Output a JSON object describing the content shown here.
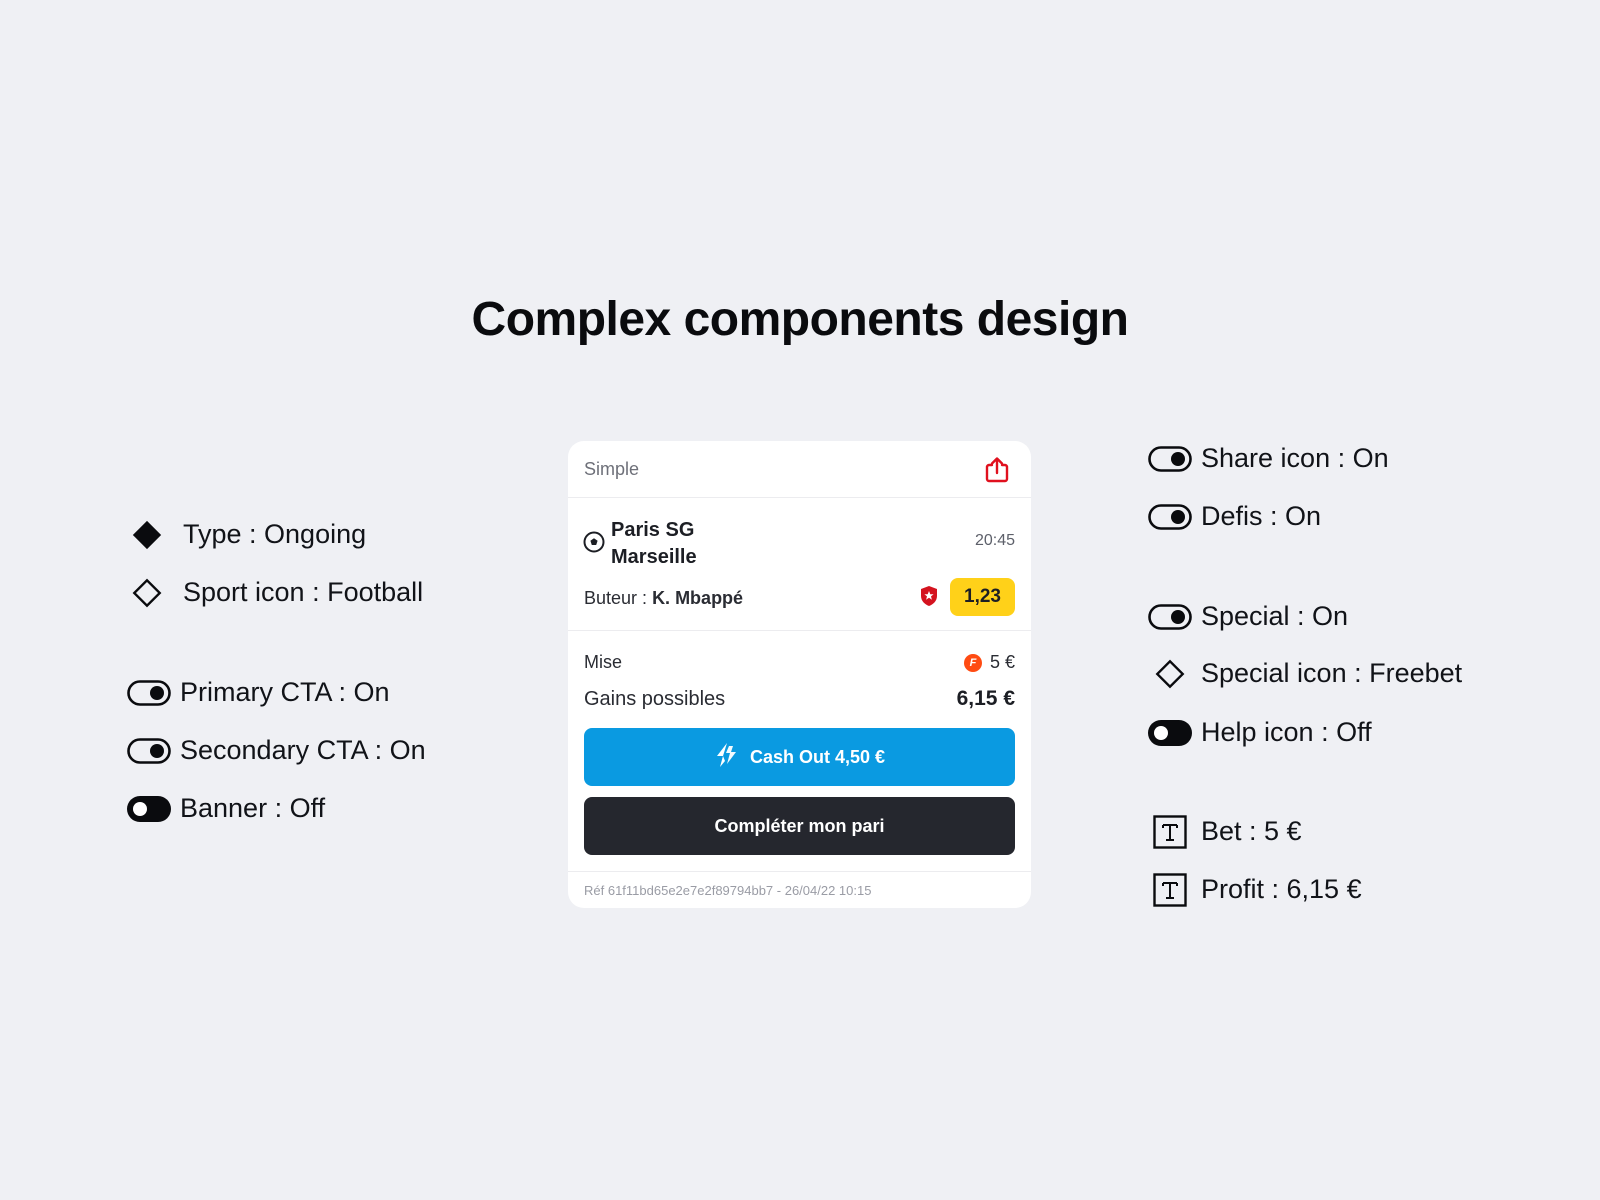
{
  "page": {
    "title": "Complex components design"
  },
  "left_props": [
    {
      "label": "Type : Ongoing",
      "icon": "filled-diamond-icon"
    },
    {
      "label": "Sport icon : Football",
      "icon": "outline-diamond-icon"
    },
    {
      "label": "Primary CTA : On",
      "icon": "toggle-on-icon"
    },
    {
      "label": "Secondary CTA : On",
      "icon": "toggle-on-icon"
    },
    {
      "label": "Banner : Off",
      "icon": "toggle-off-icon"
    }
  ],
  "right_props": [
    {
      "label": "Share icon : On",
      "icon": "toggle-on-icon"
    },
    {
      "label": "Defis : On",
      "icon": "toggle-on-icon"
    },
    {
      "label": "Special : On",
      "icon": "toggle-on-icon"
    },
    {
      "label": "Special icon : Freebet",
      "icon": "outline-diamond-icon"
    },
    {
      "label": "Help icon : Off",
      "icon": "toggle-off-icon"
    },
    {
      "label": "Bet : 5 €",
      "icon": "text-property-icon"
    },
    {
      "label": "Profit : 6,15 €",
      "icon": "text-property-icon"
    }
  ],
  "card": {
    "type_label": "Simple",
    "share_icon": "share-icon",
    "event": {
      "sport_icon": "football-icon",
      "home_team": "Paris SG",
      "away_team": "Marseille",
      "time": "20:45",
      "market_label": "Buteur :",
      "selection": "K. Mbappé",
      "special_icon": "defis-shield-icon",
      "odds": "1,23"
    },
    "stake": {
      "label": "Mise",
      "freebet_badge": "F",
      "value": "5 €"
    },
    "gains": {
      "label": "Gains possibles",
      "value": "6,15 €"
    },
    "cashout_button": {
      "label": "Cash Out 4,50 €",
      "icon": "cashout-icon"
    },
    "complete_button": {
      "label": "Compléter mon pari"
    },
    "footer_ref": "Réf 61f11bd65e2e7e2f89794bb7 - 26/04/22 10:15"
  },
  "colors": {
    "background": "#eff0f4",
    "accent_blue": "#0a9ae1",
    "dark_button": "#25272e",
    "odds_yellow": "#ffd119",
    "share_red": "#e0101e",
    "freebet_orange": "#ff4b12"
  }
}
